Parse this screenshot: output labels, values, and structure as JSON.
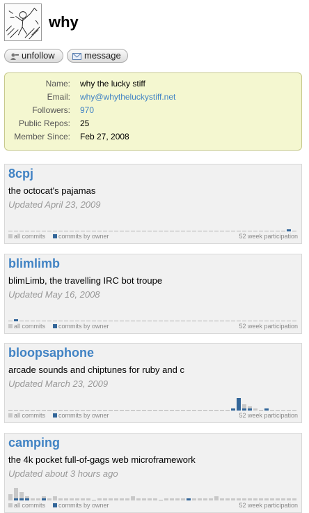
{
  "user": {
    "username": "why"
  },
  "actions": {
    "unfollow_label": "unfollow",
    "message_label": "message"
  },
  "info": [
    {
      "label": "Name:",
      "value": "why the lucky stiff",
      "link": false
    },
    {
      "label": "Email:",
      "value": "why@whytheluckystiff.net",
      "link": true
    },
    {
      "label": "Followers:",
      "value": "970",
      "link": true
    },
    {
      "label": "Public Repos:",
      "value": "25",
      "link": false
    },
    {
      "label": "Member Since:",
      "value": "Feb 27, 2008",
      "link": false
    }
  ],
  "legend": {
    "all": "all commits",
    "owner": "commits by owner",
    "participation": "52 week participation"
  },
  "colors": {
    "all": "#c8c8c8",
    "owner": "#336699",
    "link": "#4183c4"
  },
  "repos": [
    {
      "name": "8cpj",
      "description": "the octocat's pajamas",
      "updated": "Updated April 23, 2009",
      "all": [
        0,
        0,
        0,
        0,
        0,
        0,
        0,
        0,
        0,
        0,
        0,
        0,
        0,
        0,
        0,
        0,
        0,
        0,
        0,
        0,
        0,
        0,
        0,
        0,
        0,
        0,
        0,
        0,
        0,
        0,
        0,
        0,
        0,
        0,
        0,
        0,
        0,
        0,
        0,
        0,
        0,
        0,
        0,
        0,
        0,
        0,
        0,
        0,
        0,
        0,
        1,
        0
      ],
      "owner": [
        0,
        0,
        0,
        0,
        0,
        0,
        0,
        0,
        0,
        0,
        0,
        0,
        0,
        0,
        0,
        0,
        0,
        0,
        0,
        0,
        0,
        0,
        0,
        0,
        0,
        0,
        0,
        0,
        0,
        0,
        0,
        0,
        0,
        0,
        0,
        0,
        0,
        0,
        0,
        0,
        0,
        0,
        0,
        0,
        0,
        0,
        0,
        0,
        0,
        0,
        1,
        0
      ]
    },
    {
      "name": "blimlimb",
      "description": "blimLimb, the travelling IRC bot troupe",
      "updated": "Updated May 16, 2008",
      "all": [
        0,
        1,
        0,
        0,
        0,
        0,
        0,
        0,
        0,
        0,
        0,
        0,
        0,
        0,
        0,
        0,
        0,
        0,
        0,
        0,
        0,
        0,
        0,
        0,
        0,
        0,
        0,
        0,
        0,
        0,
        0,
        0,
        0,
        0,
        0,
        0,
        0,
        0,
        0,
        0,
        0,
        0,
        0,
        0,
        0,
        0,
        0,
        0,
        0,
        0,
        0,
        0
      ],
      "owner": [
        0,
        1,
        0,
        0,
        0,
        0,
        0,
        0,
        0,
        0,
        0,
        0,
        0,
        0,
        0,
        0,
        0,
        0,
        0,
        0,
        0,
        0,
        0,
        0,
        0,
        0,
        0,
        0,
        0,
        0,
        0,
        0,
        0,
        0,
        0,
        0,
        0,
        0,
        0,
        0,
        0,
        0,
        0,
        0,
        0,
        0,
        0,
        0,
        0,
        0,
        0,
        0
      ]
    },
    {
      "name": "bloopsaphone",
      "description": "arcade sounds and chiptunes for ruby and c",
      "updated": "Updated March 23, 2009",
      "all": [
        0,
        0,
        0,
        0,
        0,
        0,
        0,
        0,
        0,
        0,
        0,
        0,
        0,
        0,
        0,
        0,
        0,
        0,
        0,
        0,
        0,
        0,
        0,
        0,
        0,
        0,
        0,
        0,
        0,
        0,
        0,
        0,
        0,
        0,
        0,
        0,
        0,
        0,
        0,
        0,
        1,
        6,
        3,
        2,
        1,
        0,
        1,
        0,
        0,
        0,
        0,
        0
      ],
      "owner": [
        0,
        0,
        0,
        0,
        0,
        0,
        0,
        0,
        0,
        0,
        0,
        0,
        0,
        0,
        0,
        0,
        0,
        0,
        0,
        0,
        0,
        0,
        0,
        0,
        0,
        0,
        0,
        0,
        0,
        0,
        0,
        0,
        0,
        0,
        0,
        0,
        0,
        0,
        0,
        0,
        1,
        6,
        1,
        1,
        0,
        0,
        1,
        0,
        0,
        0,
        0,
        0
      ]
    },
    {
      "name": "camping",
      "description": "the 4k pocket full-of-gags web microframework",
      "updated": "Updated about 3 hours ago",
      "all": [
        3,
        6,
        4,
        2,
        1,
        1,
        2,
        1,
        2,
        1,
        1,
        1,
        1,
        1,
        1,
        0,
        1,
        1,
        1,
        1,
        1,
        1,
        2,
        1,
        1,
        1,
        1,
        0,
        1,
        1,
        1,
        1,
        1,
        1,
        1,
        1,
        1,
        2,
        1,
        1,
        1,
        1,
        1,
        1,
        1,
        1,
        1,
        1,
        1,
        1,
        1,
        1
      ],
      "owner": [
        0,
        1,
        1,
        1,
        0,
        0,
        1,
        0,
        0,
        0,
        0,
        0,
        0,
        0,
        0,
        0,
        0,
        0,
        0,
        0,
        0,
        0,
        0,
        0,
        0,
        0,
        0,
        0,
        0,
        0,
        0,
        0,
        1,
        0,
        0,
        0,
        0,
        0,
        0,
        0,
        0,
        0,
        0,
        0,
        0,
        0,
        0,
        0,
        0,
        0,
        0,
        0
      ]
    }
  ]
}
